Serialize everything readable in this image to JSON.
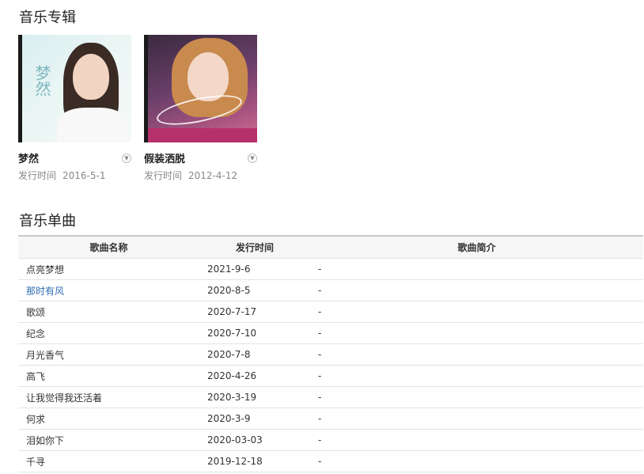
{
  "albums_section": {
    "title": "音乐专辑",
    "items": [
      {
        "name": "梦然",
        "date_label": "发行时间",
        "date": "2016-5-1",
        "cover_text": "梦然"
      },
      {
        "name": "假装洒脱",
        "date_label": "发行时间",
        "date": "2012-4-12"
      }
    ]
  },
  "singles_section": {
    "title": "音乐单曲",
    "columns": [
      "歌曲名称",
      "发行时间",
      "歌曲简介"
    ],
    "rows": [
      {
        "name": "点亮梦想",
        "date": "2021-9-6",
        "desc": "-"
      },
      {
        "name": "那时有风",
        "date": "2020-8-5",
        "desc": "-",
        "link": true
      },
      {
        "name": "歌颂",
        "date": "2020-7-17",
        "desc": "-"
      },
      {
        "name": "纪念",
        "date": "2020-7-10",
        "desc": "-"
      },
      {
        "name": "月光香气",
        "date": "2020-7-8",
        "desc": "-"
      },
      {
        "name": "高飞",
        "date": "2020-4-26",
        "desc": "-"
      },
      {
        "name": "让我觉得我还活着",
        "date": "2020-3-19",
        "desc": "-"
      },
      {
        "name": "何求",
        "date": "2020-3-9",
        "desc": "-"
      },
      {
        "name": "泪如你下",
        "date": "2020-03-03",
        "desc": "-"
      },
      {
        "name": "千寻",
        "date": "2019-12-18",
        "desc": "-"
      }
    ]
  },
  "colors": {
    "link": "#2b6cb0",
    "header_bg": "#f6f6f6",
    "border": "#c8c8c8"
  }
}
